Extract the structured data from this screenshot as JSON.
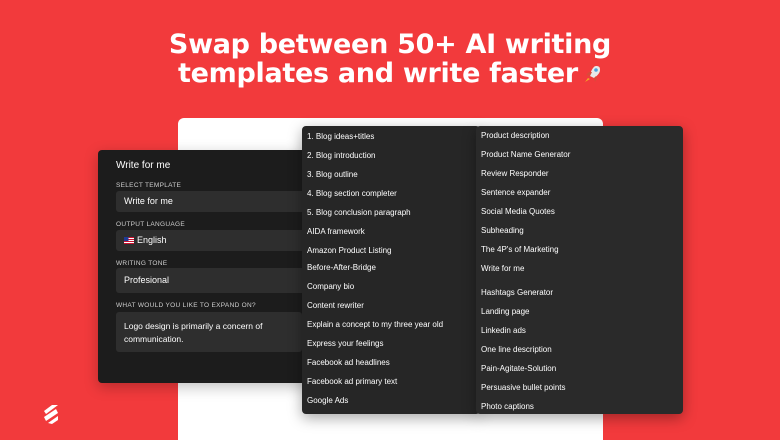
{
  "headline": {
    "line1": "Swap between 50+ AI writing",
    "line2": "templates and write faster",
    "emoji": "rocket-icon"
  },
  "panel": {
    "title": "Write for me",
    "template_label": "SELECT TEMPLATE",
    "template_value": "Write for me",
    "language_label": "OUTPUT LANGUAGE",
    "language_value": "English",
    "tone_label": "WRITING TONE",
    "tone_value": "Profesional",
    "expand_label": "WHAT WOULD YOU LIKE TO EXPAND ON?",
    "expand_value": "Logo design is primarily a concern of communication."
  },
  "menu_left": [
    "1. Blog ideas+titles",
    "2. Blog introduction",
    "3. Blog outline",
    "4. Blog section completer",
    "5. Blog conclusion paragraph",
    "AIDA framework",
    "Amazon Product Listing",
    "Before-After-Bridge",
    "Company bio",
    "Content rewriter",
    "Explain a concept to my three year old",
    "Express your feelings",
    "Facebook ad headlines",
    "Facebook ad primary text",
    "Google Ads"
  ],
  "menu_right": [
    "Product description",
    "Product Name Generator",
    "Review Responder",
    "Sentence expander",
    "Social Media Quotes",
    "Subheading",
    "The 4P's of Marketing",
    "Write for me",
    "Hashtags Generator",
    "Landing page",
    "Linkedin ads",
    "One line description",
    "Pain-Agitate-Solution",
    "Persuasive bullet points",
    "Photo captions"
  ],
  "colors": {
    "background": "#f23a3c",
    "panel": "#1c1c1c",
    "field": "#2e2e2e",
    "menu": "#262626"
  }
}
